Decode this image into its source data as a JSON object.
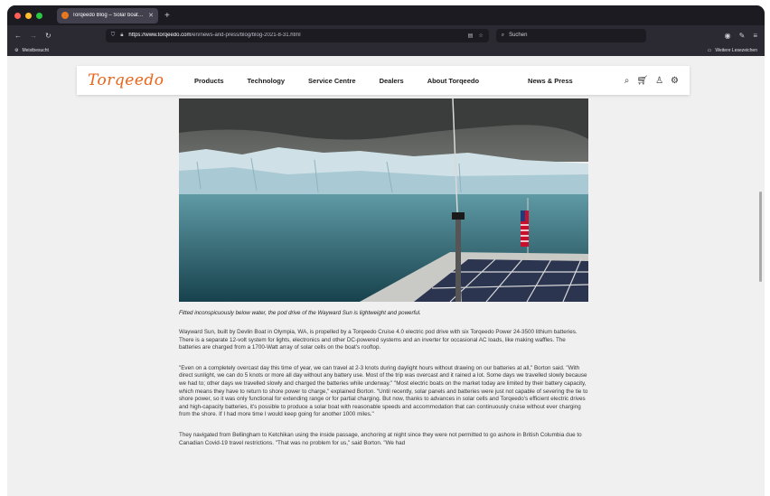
{
  "browser": {
    "tab_title": "Torqeedo Blog – Solar boat cruis...",
    "url_host": "https://www.torqeedo.com",
    "url_path": "/en/news-and-press/blog/blog-2021-8-31.html",
    "search_placeholder": "Suchen",
    "bookmark_left": "Meistbesucht",
    "bookmark_right": "Weitere Lesezeichen",
    "colors": {
      "close": "#ff5f57",
      "minimize": "#febc2e",
      "maximize": "#28c840"
    }
  },
  "site": {
    "logo": "Torqeedo",
    "logo_color": "#e8651a",
    "nav": [
      "Products",
      "Technology",
      "Service Centre",
      "Dealers",
      "About Torqeedo",
      "News & Press"
    ]
  },
  "article": {
    "caption": "Fitted inconspicuously below water, the pod drive of the Wayward Sun is lightweight and powerful.",
    "paragraphs": [
      "Wayward Sun, built by Devlin Boat in Olympia, WA, is propelled by a Torqeedo Cruise 4.0 electric pod drive with six Torqeedo Power 24-3500 lithium batteries. There is a separate 12-volt system for lights, electronics and other DC-powered systems and an inverter for occasional AC loads, like making waffles. The batteries are charged from a 1700-Watt array of solar cells on the boat's rooftop.",
      "\"Even on a completely overcast day this time of year, we can travel at 2-3 knots during daylight hours without drawing on our batteries at all,\" Borton said. \"With direct sunlight, we can do 5 knots or more all day without any battery use. Most of the trip was overcast and it rained a lot. Some days we travelled slowly because we had to; other days we travelled slowly and charged the batteries while underway.\" \"Most electric boats on the market today are limited by their battery capacity, which means they have to return to shore power to charge,\" explained Borton. \"Until recently, solar panels and batteries were just not capable of severing the tie to shore power, so it was only functional for extending range or for partial charging. But now, thanks to advances in solar cells and Torqeedo's efficient electric drives and high-capacity batteries, it's possible to produce a solar boat with reasonable speeds and accommodation that can continuously cruise without ever charging from the shore. If I had more time I would keep going for another 1000 miles.\"",
      "They navigated from Bellingham to Ketchikan using the inside passage, anchoring at night since they were not permitted to go ashore in British Columbia due to Canadian Covid-19 travel restrictions. \"That was no problem for us,\" said Borton. \"We had"
    ]
  }
}
